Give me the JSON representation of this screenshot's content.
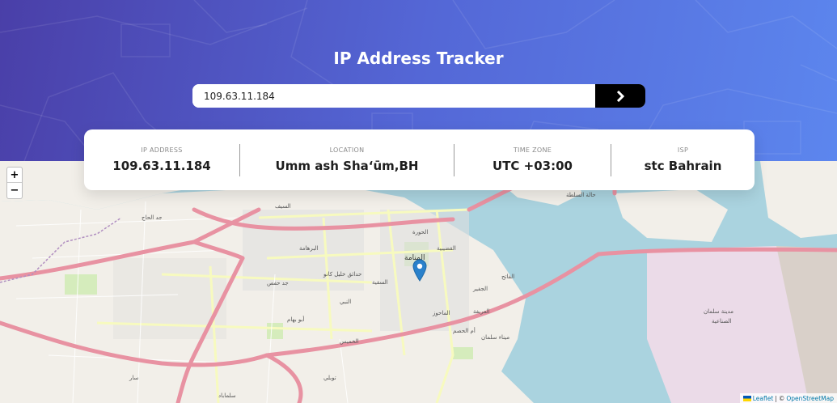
{
  "header": {
    "title": "IP Address Tracker"
  },
  "search": {
    "value": "109.63.11.184",
    "submit_icon": "chevron-right-icon"
  },
  "info": {
    "ip": {
      "label": "IP ADDRESS",
      "value": "109.63.11.184"
    },
    "location": {
      "label": "LOCATION",
      "value": "Umm ash Sha‘ūm,BH"
    },
    "timezone": {
      "label": "TIME ZONE",
      "value": "UTC +03:00"
    },
    "isp": {
      "label": "ISP",
      "value": "stc Bahrain"
    }
  },
  "map": {
    "zoom_in": "+",
    "zoom_out": "−",
    "attribution": {
      "leaflet": "Leaflet",
      "separator": "|",
      "copyright": "©",
      "osm": "OpenStreetMap"
    },
    "labels": [
      "المنامة",
      "السقية",
      "الحورة",
      "القضيبية",
      "الجفير",
      "الفاتح",
      "العريفة",
      "الماحوز",
      "أم الحصم",
      "ميناء سلمان",
      "جد حفص",
      "البرهامة",
      "السيف",
      "جد الحاج",
      "أبو بهام",
      "سار",
      "توبلي",
      "سلماباد",
      "الصناعية",
      "مدينة سلمان",
      "حالة السلطة",
      "حدائق خليل كانو",
      "النبي",
      "الخميس"
    ]
  },
  "colors": {
    "hero_start": "#4a3fa8",
    "hero_end": "#5c86ee",
    "sea": "#aad3df",
    "land": "#f2efe9",
    "road_major": "#e892a2",
    "road_secondary": "#f7fabf",
    "marker": "#2a81cb"
  }
}
